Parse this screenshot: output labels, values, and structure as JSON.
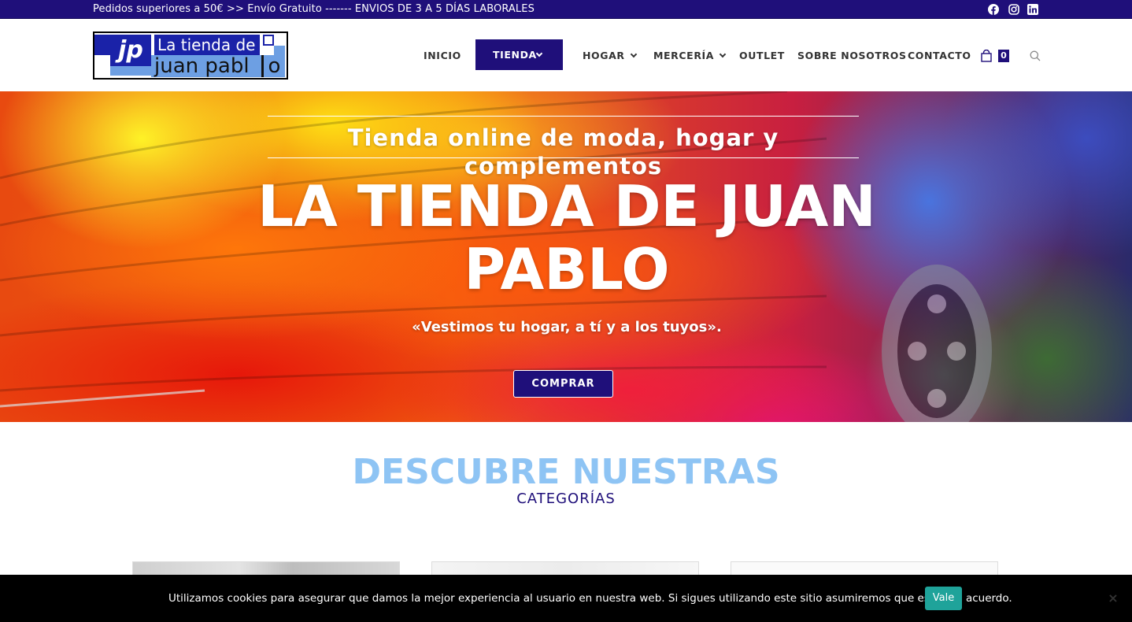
{
  "topbar": {
    "text": "Pedidos superiores a 50€ >> Envío Gratuito ------- ENVIOS DE 3 A 5 DÍAS LABORALES",
    "social": [
      "facebook-icon",
      "instagram-icon",
      "linkedin-icon"
    ]
  },
  "logo": {
    "jp": "jp",
    "line1": "La tienda de",
    "line2": "juan pabl",
    "line2_end": "o"
  },
  "nav": {
    "items": [
      {
        "label": "INICIO"
      },
      {
        "label": "TIENDA",
        "active": true
      },
      {
        "label": "HOGAR"
      },
      {
        "label": "MERCERÍA"
      },
      {
        "label": "OUTLET"
      },
      {
        "label": "SOBRE NOSOTROS"
      },
      {
        "label": "CONTACTO"
      }
    ],
    "cart_count": "0"
  },
  "hero": {
    "subtitle": "Tienda online de moda, hogar y complementos",
    "title": "LA TIENDA DE JUAN PABLO",
    "tagline": "«Vestimos tu hogar, a tí y a los tuyos».",
    "button": "COMPRAR"
  },
  "categories": {
    "title": "DESCUBRE NUESTRAS",
    "subtitle": "CATEGORÍAS"
  },
  "cookie": {
    "text": "Utilizamos cookies para asegurar que damos la mejor experiencia al usuario en nuestra web. Si sigues utilizando este sitio asumiremos que estás de acuerdo.",
    "button": "Vale",
    "close": "×"
  },
  "colors": {
    "brand": "#1f0f7a",
    "accent_light": "#8ec4f4",
    "cookie_button": "#1fa39a"
  }
}
